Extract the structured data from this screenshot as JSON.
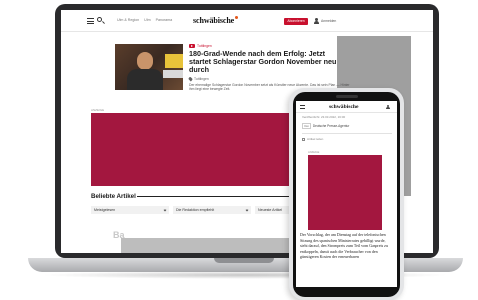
{
  "site": {
    "logo": "schwäbische",
    "breadcrumbs": [
      "Ulm & Region",
      "Ulm",
      "Panorama"
    ],
    "abo_button": "Abonnieren",
    "login_label": "Anmelden"
  },
  "article": {
    "tag": "Tuttlingen",
    "title": "180-Grad-Wende nach dem Erfolg: Jetzt startet Schlagerstar Gordon November neu durch",
    "location": "Tuttlingen",
    "teaser": "Der ehemalige Schlagerstar Gordon November setzt als Künstler neue Akzente. Das ist sein Plan — Hinter ihm liegt eine bewegte Zeit."
  },
  "ads": {
    "label": "ANZEIGE"
  },
  "popular": {
    "heading": "Beliebte Artikel",
    "tabs": [
      "Meistgelesen",
      "Die Redaktion empfiehlt",
      "Neueste Artikel"
    ]
  },
  "footer_peek": "Ba",
  "mobile": {
    "logo": "schwäbische",
    "date": "Veröffentlicht: 23.03.2022, 16:00",
    "source_chip": "Von",
    "source": "Deutsche Presse-Agentur",
    "tool": "Artikel teilen",
    "ad_label": "ANZEIGE",
    "body": "Der Vorschlag, der am Dienstag auf der telefonischen Sitzung des spanischen Ministerrates gebilligt wurde, sieht darauf, den Strompreis zum Teil vom Gaspreis zu entkoppeln, damit auch die Verbraucher von den günstigeren Kosten der erneuerbaren"
  },
  "colors": {
    "brand_red": "#c8102e",
    "ad_crimson": "#a3173f",
    "logo_accent": "#e4581b"
  }
}
